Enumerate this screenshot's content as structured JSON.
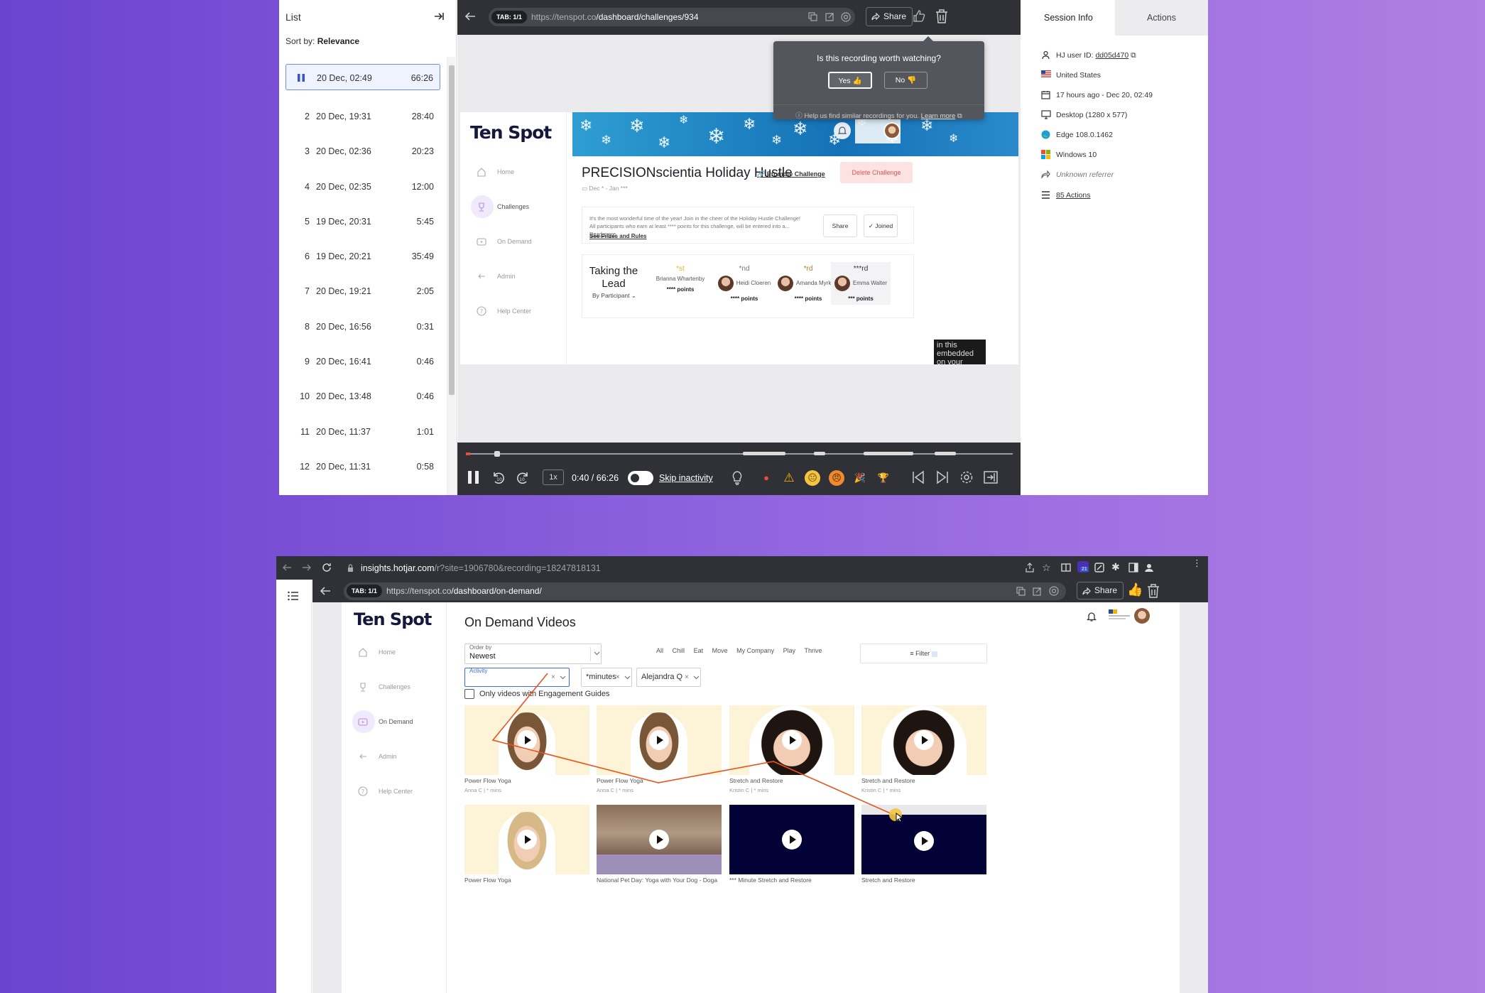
{
  "list_panel": {
    "title": "List",
    "sort_label": "Sort by:",
    "sort_value": "Relevance",
    "recordings": [
      {
        "num": "",
        "date": "20 Dec, 02:49",
        "duration": "66:26"
      },
      {
        "num": "2",
        "date": "20 Dec, 19:31",
        "duration": "28:40"
      },
      {
        "num": "3",
        "date": "20 Dec, 02:36",
        "duration": "20:23"
      },
      {
        "num": "4",
        "date": "20 Dec, 02:35",
        "duration": "12:00"
      },
      {
        "num": "5",
        "date": "19 Dec, 20:31",
        "duration": "5:45"
      },
      {
        "num": "6",
        "date": "19 Dec, 20:21",
        "duration": "35:49"
      },
      {
        "num": "7",
        "date": "20 Dec, 19:21",
        "duration": "2:05"
      },
      {
        "num": "8",
        "date": "20 Dec, 16:56",
        "duration": "0:31"
      },
      {
        "num": "9",
        "date": "20 Dec, 16:41",
        "duration": "0:46"
      },
      {
        "num": "10",
        "date": "20 Dec, 13:48",
        "duration": "0:46"
      },
      {
        "num": "11",
        "date": "20 Dec, 11:37",
        "duration": "1:01"
      },
      {
        "num": "12",
        "date": "20 Dec, 11:31",
        "duration": "0:58"
      }
    ]
  },
  "player_top": {
    "tab_badge": "TAB: 1/1",
    "url_prefix": "https://tenspot.co",
    "url_path": "/dashboard/challenges/934",
    "share_label": "Share",
    "popup": {
      "question": "Is this recording worth watching?",
      "yes": "Yes 👍",
      "no": "No 👎",
      "hint": "Help us find similar recordings for you.",
      "learn_more": "Learn more"
    },
    "site": {
      "logo": "Ten Spot",
      "nav": [
        "Home",
        "Challenges",
        "On Demand",
        "Admin",
        "Help Center"
      ],
      "challenge_title": "PRECISIONscientia Holiday Hustle",
      "promote": "Promote Challenge",
      "date_range": "Dec * - Jan ***",
      "delete": "Delete Challenge",
      "description": "It's the most wonderful time of the year! Join in the cheer of the Holiday Hustle Challenge! All participants who earn at least **** points for this challenge, will be entered into a...",
      "read_more": "Read more",
      "see_prizes": "See Prizes and Rules",
      "share": "Share",
      "joined": "Joined",
      "lead_title": "Taking the Lead",
      "lead_by": "By Participant",
      "leaders": [
        {
          "rank": "*st",
          "name": "Brianna Whartenby",
          "points": "**** points"
        },
        {
          "rank": "*nd",
          "name": "Heidi Cloeren",
          "points": "**** points"
        },
        {
          "rank": "*rd",
          "name": "Amanda Myrkalo",
          "points": "**** points"
        },
        {
          "rank": "***rd",
          "name": "Emma Walter",
          "points": "*** points"
        }
      ],
      "embedded_text": "in this embedded on your"
    },
    "controls": {
      "speed": "1x",
      "time": "0:40 / 66:26",
      "skip": "Skip inactivity"
    }
  },
  "session_info": {
    "tabs": [
      "Session Info",
      "Actions"
    ],
    "user_label": "HJ user ID:",
    "user_id": "dd05d470",
    "country": "United States",
    "time": "17 hours ago - Dec 20, 02:49",
    "device": "Desktop (1280 x 577)",
    "browser": "Edge 108.0.1462",
    "os": "Windows 10",
    "referrer": "Unknown referrer",
    "actions": "85 Actions"
  },
  "browser_bottom": {
    "url_host": "insights.hotjar.com",
    "url_rest": "/r?site=1906780&recording=18247818131",
    "ext_badge": "21",
    "tab_badge": "TAB: 1/1",
    "url_prefix": "https://tenspot.co",
    "url_path": "/dashboard/on-demand/",
    "share_label": "Share"
  },
  "on_demand": {
    "logo": "Ten Spot",
    "nav": [
      "Home",
      "Challenges",
      "On Demand",
      "Admin",
      "Help Center"
    ],
    "title": "On Demand Videos",
    "order_label": "Order by",
    "order_value": "Newest",
    "categories": [
      "All",
      "Chill",
      "Eat",
      "Move",
      "My Company",
      "Play",
      "Thrive"
    ],
    "filter": "Filter",
    "activity_label": "Activity",
    "minutes_filter": "*minutes",
    "instructor_filter": "Alejandra Q",
    "engagement_check": "Only videos with Engagement Guides",
    "videos": [
      {
        "title": "Power Flow Yoga",
        "meta": "Anna C  |  * mins"
      },
      {
        "title": "Power Flow Yoga",
        "meta": "Anna C  |  * mins"
      },
      {
        "title": "Stretch and Restore",
        "meta": "Kristin C  |  * mins"
      },
      {
        "title": "Stretch and Restore",
        "meta": "Kristin C  |  * mins"
      },
      {
        "title": "Power Flow Yoga",
        "meta": ""
      },
      {
        "title": "National Pet Day: Yoga with Your Dog - Doga",
        "meta": ""
      },
      {
        "title": "*** Minute Stretch and Restore",
        "meta": ""
      },
      {
        "title": "Stretch and Restore",
        "meta": ""
      }
    ]
  },
  "colors": {
    "background_left": "#6a43cf",
    "background_right": "#b07fe3",
    "player_chrome": "#2f3136",
    "mouse_trail": "#e8541e",
    "link_blue": "#3a6ee8"
  }
}
